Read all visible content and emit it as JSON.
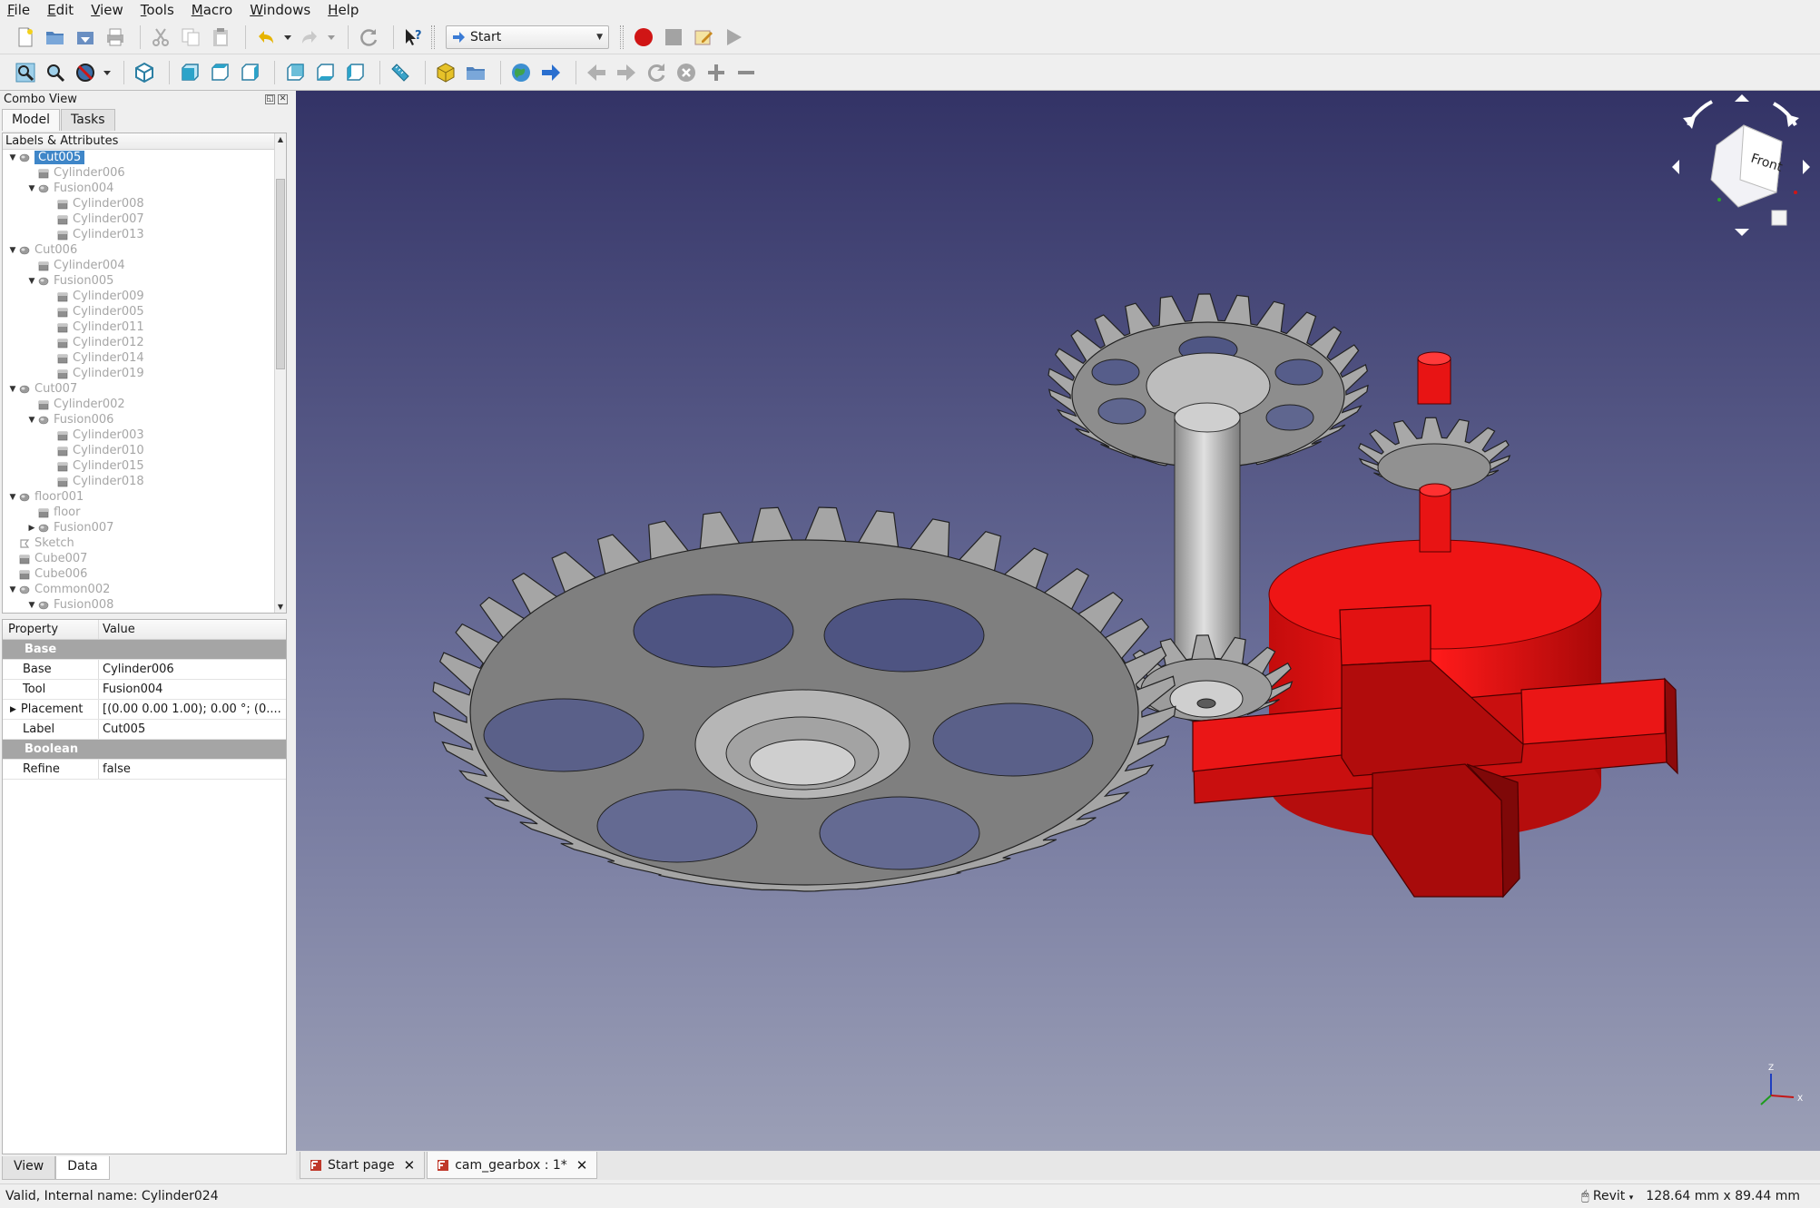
{
  "menubar": [
    "File",
    "Edit",
    "View",
    "Tools",
    "Macro",
    "Windows",
    "Help"
  ],
  "toolbar": {
    "file_icons": [
      "new-file-icon",
      "open-file-icon",
      "save-icon",
      "print-icon"
    ],
    "edit_icons": [
      "cut-icon",
      "copy-icon",
      "paste-icon"
    ],
    "history_icons": [
      "undo-icon",
      "redo-icon",
      "refresh-icon",
      "whats-this-icon"
    ],
    "workbench": "Start",
    "macro_icons": [
      "record-macro-icon",
      "stop-macro-icon",
      "edit-macro-icon",
      "run-macro-icon"
    ],
    "view_icons": [
      "fit-all-icon",
      "fit-selection-icon",
      "draw-style-icon",
      "isometric-view-icon",
      "front-view-icon",
      "top-view-icon",
      "right-view-icon",
      "rear-view-icon",
      "bottom-view-icon",
      "left-view-icon",
      "measure-distance-icon",
      "part-icon",
      "group-icon",
      "web-browser-icon",
      "go-forward-icon",
      "back-arrow-icon",
      "forward-arrow-icon",
      "reload-icon",
      "stop-icon",
      "zoom-in-icon",
      "zoom-out-icon"
    ]
  },
  "combo": {
    "title": "Combo View",
    "tabs": [
      "Model",
      "Tasks"
    ],
    "tree_header": "Labels & Attributes",
    "tree": [
      {
        "label": "Cut005",
        "level": 0,
        "arrow": "down",
        "icon": "cut",
        "selected": true
      },
      {
        "label": "Cylinder006",
        "level": 1,
        "arrow": "",
        "icon": "cyl"
      },
      {
        "label": "Fusion004",
        "level": 1,
        "arrow": "down",
        "icon": "fusion"
      },
      {
        "label": "Cylinder008",
        "level": 2,
        "arrow": "",
        "icon": "cyl"
      },
      {
        "label": "Cylinder007",
        "level": 2,
        "arrow": "",
        "icon": "cyl"
      },
      {
        "label": "Cylinder013",
        "level": 2,
        "arrow": "",
        "icon": "cyl"
      },
      {
        "label": "Cut006",
        "level": 0,
        "arrow": "down",
        "icon": "cut"
      },
      {
        "label": "Cylinder004",
        "level": 1,
        "arrow": "",
        "icon": "cyl"
      },
      {
        "label": "Fusion005",
        "level": 1,
        "arrow": "down",
        "icon": "fusion"
      },
      {
        "label": "Cylinder009",
        "level": 2,
        "arrow": "",
        "icon": "cyl"
      },
      {
        "label": "Cylinder005",
        "level": 2,
        "arrow": "",
        "icon": "cyl"
      },
      {
        "label": "Cylinder011",
        "level": 2,
        "arrow": "",
        "icon": "cyl"
      },
      {
        "label": "Cylinder012",
        "level": 2,
        "arrow": "",
        "icon": "cyl"
      },
      {
        "label": "Cylinder014",
        "level": 2,
        "arrow": "",
        "icon": "cyl"
      },
      {
        "label": "Cylinder019",
        "level": 2,
        "arrow": "",
        "icon": "cyl"
      },
      {
        "label": "Cut007",
        "level": 0,
        "arrow": "down",
        "icon": "cut"
      },
      {
        "label": "Cylinder002",
        "level": 1,
        "arrow": "",
        "icon": "cyl"
      },
      {
        "label": "Fusion006",
        "level": 1,
        "arrow": "down",
        "icon": "fusion"
      },
      {
        "label": "Cylinder003",
        "level": 2,
        "arrow": "",
        "icon": "cyl"
      },
      {
        "label": "Cylinder010",
        "level": 2,
        "arrow": "",
        "icon": "cyl"
      },
      {
        "label": "Cylinder015",
        "level": 2,
        "arrow": "",
        "icon": "cyl"
      },
      {
        "label": "Cylinder018",
        "level": 2,
        "arrow": "",
        "icon": "cyl"
      },
      {
        "label": "floor001",
        "level": 0,
        "arrow": "down",
        "icon": "cut"
      },
      {
        "label": "floor",
        "level": 1,
        "arrow": "",
        "icon": "cube"
      },
      {
        "label": "Fusion007",
        "level": 1,
        "arrow": "right",
        "icon": "fusion"
      },
      {
        "label": "Sketch",
        "level": 0,
        "arrow": "",
        "icon": "sketch"
      },
      {
        "label": "Cube007",
        "level": 0,
        "arrow": "",
        "icon": "cube"
      },
      {
        "label": "Cube006",
        "level": 0,
        "arrow": "",
        "icon": "cube"
      },
      {
        "label": "Common002",
        "level": 0,
        "arrow": "down",
        "icon": "common"
      },
      {
        "label": "Fusion008",
        "level": 1,
        "arrow": "down",
        "icon": "fusion"
      }
    ],
    "props": {
      "col_property": "Property",
      "col_value": "Value",
      "group_base": "Base",
      "base_label": "Base",
      "base_value": "Cylinder006",
      "tool_label": "Tool",
      "tool_value": "Fusion004",
      "placement_label": "Placement",
      "placement_value": "[(0.00 0.00 1.00); 0.00 °; (0....",
      "label_label": "Label",
      "label_value": "Cut005",
      "group_boolean": "Boolean",
      "refine_label": "Refine",
      "refine_value": "false"
    },
    "prop_tabs": [
      "View",
      "Data"
    ]
  },
  "navcube": {
    "face": "Front"
  },
  "axis": {
    "z": "Z",
    "x": "X"
  },
  "doctabs": [
    {
      "label": "Start page",
      "active": false
    },
    {
      "label": "cam_gearbox : 1*",
      "active": true
    }
  ],
  "status": {
    "message": "Valid, Internal name: Cylinder024",
    "nav_style": "Revit",
    "dimensions": "128.64 mm x 89.44 mm"
  },
  "colors": {
    "viewport_top": "#333366",
    "viewport_bottom": "#9b9fb6",
    "selection": "#3f86c8",
    "gear_grey": "#8c8c8c",
    "red_part": "#d41010"
  }
}
